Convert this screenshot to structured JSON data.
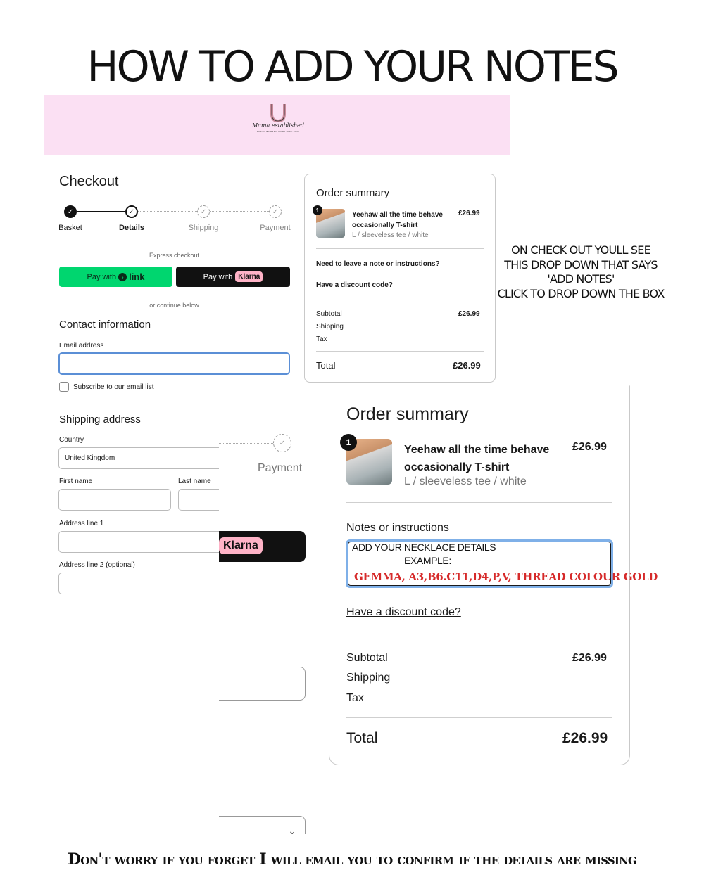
{
  "heading": "HOW TO ADD YOUR NOTES",
  "brand": {
    "logo_script": "Mama established",
    "logo_tagline": "DREAM BY RANG WORK WITH GRIT"
  },
  "checkout": {
    "title": "Checkout",
    "steps": [
      {
        "label": "Basket",
        "state": "done"
      },
      {
        "label": "Details",
        "state": "current"
      },
      {
        "label": "Shipping",
        "state": "todo"
      },
      {
        "label": "Payment",
        "state": "todo"
      }
    ],
    "express_label": "Express checkout",
    "link_button": {
      "prefix": "Pay with",
      "brand": "link"
    },
    "klarna_button": {
      "prefix": "Pay with",
      "brand": "Klarna"
    },
    "continue_label": "or continue below",
    "contact": {
      "title": "Contact information",
      "email_label": "Email address",
      "email_value": "",
      "subscribe_label": "Subscribe to our email list",
      "subscribe_checked": false
    },
    "shipping": {
      "title": "Shipping address",
      "country_label": "Country",
      "country_value": "United Kingdom",
      "first_name_label": "First name",
      "last_name_label": "Last name",
      "address1_label": "Address line 1",
      "address2_label": "Address line 2 (optional)"
    }
  },
  "overflow": {
    "payment_step_label": "Payment",
    "klarna_label": "Klarna"
  },
  "summary_small": {
    "title": "Order summary",
    "item": {
      "quantity": "1",
      "name": "Yeehaw all the time behave occasionally T-shirt",
      "variant": "L / sleeveless tee / white",
      "price": "£26.99"
    },
    "note_link": "Need to leave a note or instructions?",
    "discount_link": "Have a discount code?",
    "subtotal_label": "Subtotal",
    "subtotal_value": "£26.99",
    "shipping_label": "Shipping",
    "tax_label": "Tax",
    "total_label": "Total",
    "total_value": "£26.99"
  },
  "instructions": {
    "line1": "ON CHECK OUT YOULL SEE",
    "line2": "THIS DROP DOWN THAT SAYS",
    "line3": "'ADD NOTES'",
    "line4": "CLICK TO DROP DOWN THE BOX"
  },
  "summary_large": {
    "title": "Order summary",
    "item": {
      "quantity": "1",
      "name_line1": "Yeehaw all the time behave",
      "name_line2": "occasionally T-shirt",
      "variant": "L / sleeveless tee / white",
      "price": "£26.99"
    },
    "notes_label": "Notes or instructions",
    "notes_line1": "ADD YOUR NECKLACE DETAILS",
    "notes_line2": "EXAMPLE:",
    "notes_line3": "GEMMA, A3,B6.C11,D4,P,V, THREAD COLOUR GOLD",
    "discount_link": "Have a discount code?",
    "subtotal_label": "Subtotal",
    "subtotal_value": "£26.99",
    "shipping_label": "Shipping",
    "tax_label": "Tax",
    "total_label": "Total",
    "total_value": "£26.99"
  },
  "footer_note": "Don't worry if you forget I will email you to confirm if the details are missing",
  "colors": {
    "banner": "#fbe0f3",
    "link_green": "#00d66f",
    "klarna_pink": "#ffb3c7",
    "focus_blue": "#5b8fd6",
    "example_red": "#d62a2a"
  }
}
